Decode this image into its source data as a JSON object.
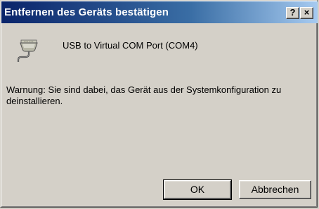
{
  "window": {
    "title": "Entfernen des Geräts bestätigen",
    "help_label": "?",
    "close_label": "×"
  },
  "device": {
    "icon": "usb-serial-connector-icon",
    "name": "USB to Virtual COM Port (COM4)"
  },
  "message": {
    "warning": "Warnung: Sie sind dabei, das Gerät aus der Systemkonfiguration zu deinstallieren."
  },
  "buttons": {
    "ok_label": "OK",
    "cancel_label": "Abbrechen"
  },
  "colors": {
    "titlebar_start": "#0a246a",
    "titlebar_end": "#a6caf0",
    "dialog_background": "#d4d0c8"
  }
}
